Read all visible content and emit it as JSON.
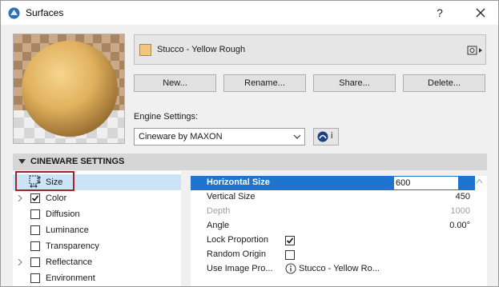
{
  "window": {
    "title": "Surfaces",
    "help": "?"
  },
  "material": {
    "name": "Stucco - Yellow Rough",
    "swatch_color": "#f1c780"
  },
  "buttons": {
    "new": "New...",
    "rename": "Rename...",
    "share": "Share...",
    "delete": "Delete..."
  },
  "engine": {
    "label": "Engine Settings:",
    "value": "Cineware by MAXON",
    "info": "i"
  },
  "section": {
    "title": "CINEWARE SETTINGS"
  },
  "channels": [
    {
      "label": "Size",
      "checked": false,
      "expandable": false
    },
    {
      "label": "Color",
      "checked": true,
      "expandable": true
    },
    {
      "label": "Diffusion",
      "checked": false,
      "expandable": false
    },
    {
      "label": "Luminance",
      "checked": false,
      "expandable": false
    },
    {
      "label": "Transparency",
      "checked": false,
      "expandable": false
    },
    {
      "label": "Reflectance",
      "checked": false,
      "expandable": true
    },
    {
      "label": "Environment",
      "checked": false,
      "expandable": false
    }
  ],
  "properties": [
    {
      "label": "Horizontal Size",
      "value": "600"
    },
    {
      "label": "Vertical Size",
      "value": "450"
    },
    {
      "label": "Depth",
      "value": "1000"
    },
    {
      "label": "Angle",
      "value": "0.00°"
    },
    {
      "label": "Lock Proportion",
      "checked": true
    },
    {
      "label": "Random Origin",
      "checked": false
    },
    {
      "label": "Use Image Pro...",
      "value": "Stucco - Yellow Ro..."
    }
  ],
  "colors": {
    "selection": "#1f74cf",
    "list_selection": "#cce4f7",
    "highlight_frame": "#a1262b"
  }
}
